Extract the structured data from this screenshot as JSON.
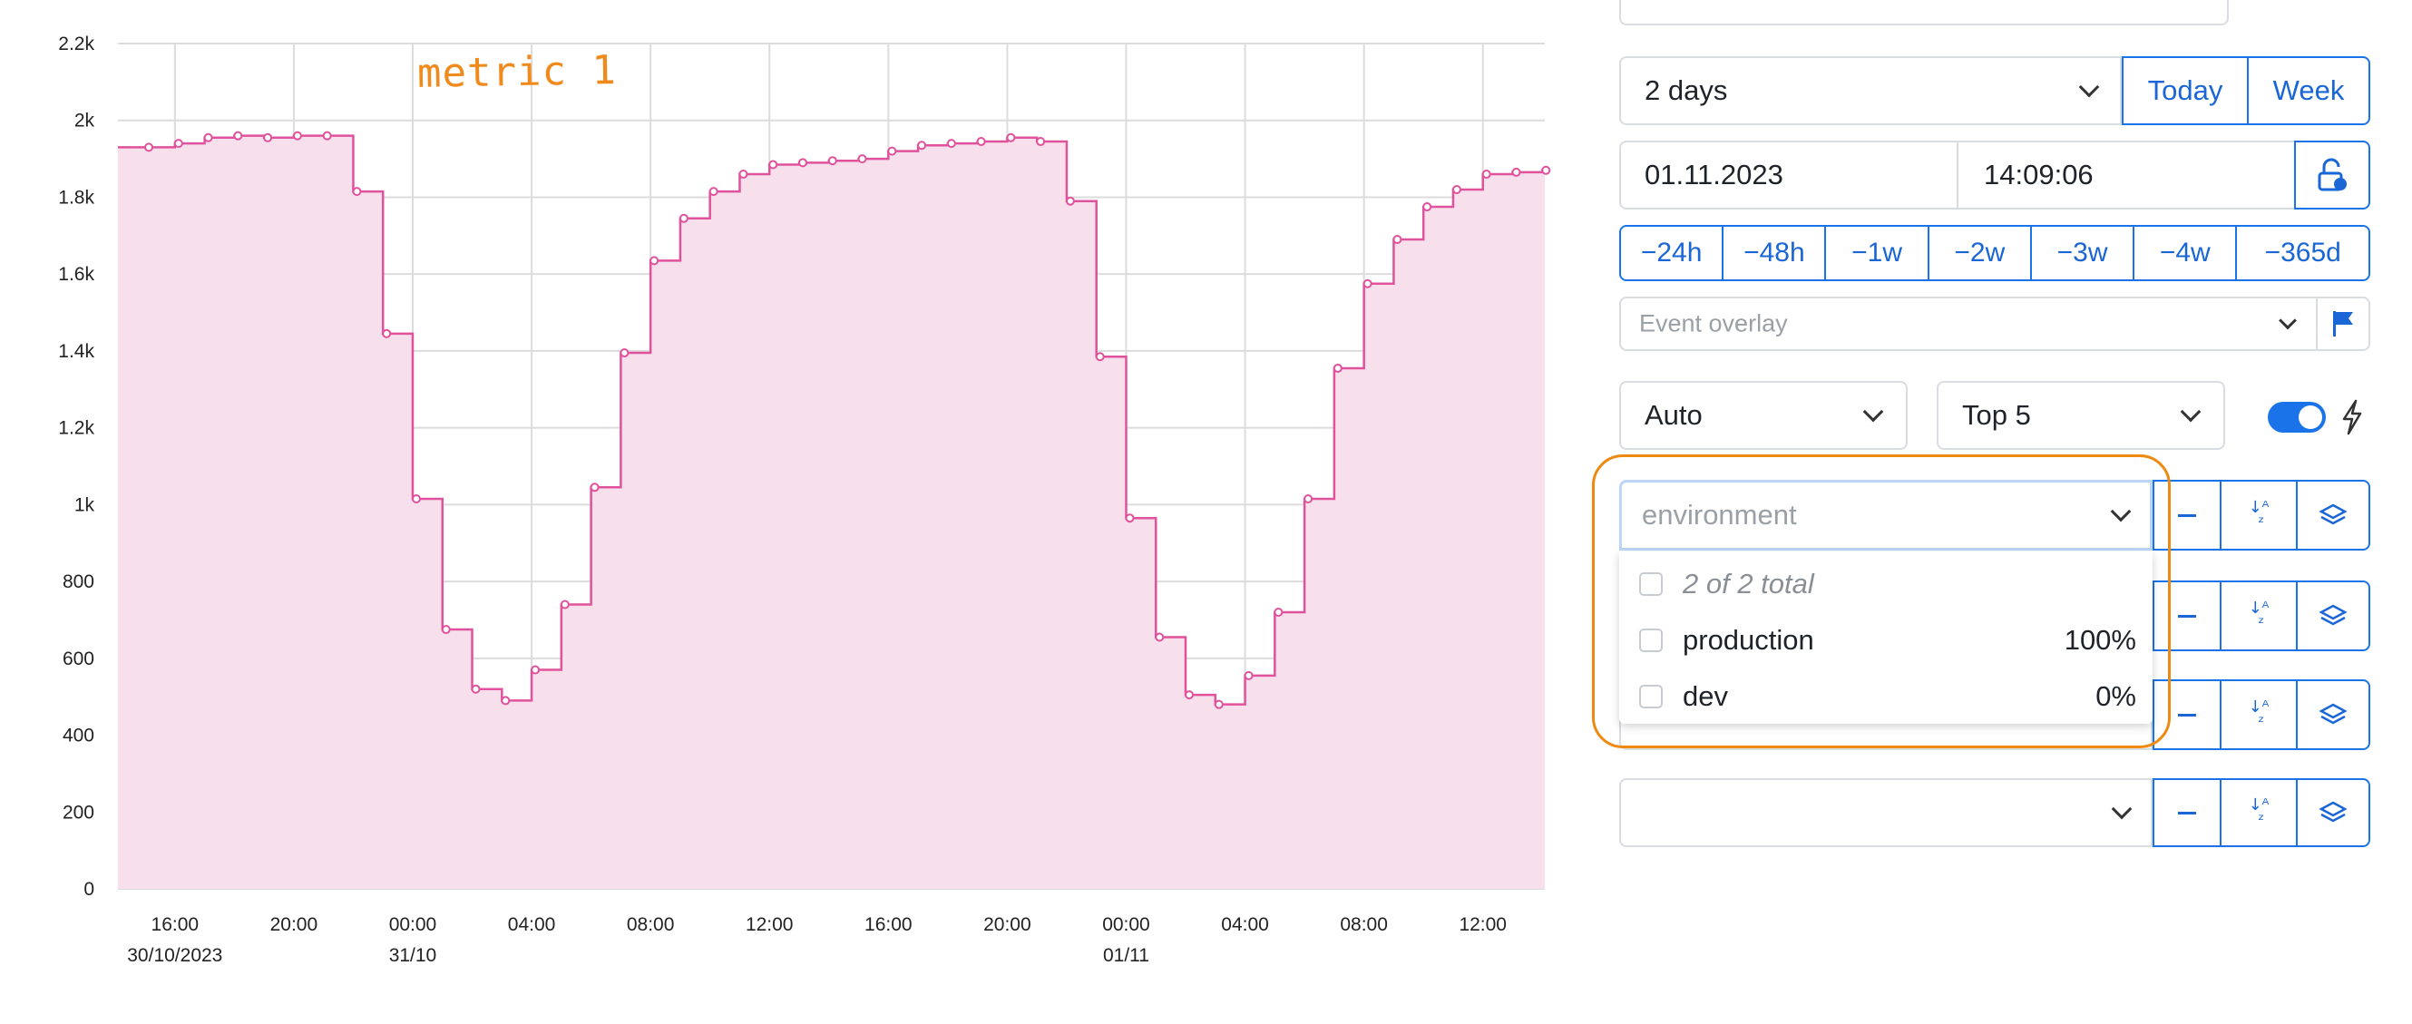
{
  "chart_data": {
    "type": "area",
    "step": true,
    "color": "#e0529c",
    "fill": "#f8dfec",
    "annotation": "metric 1",
    "ylim": [
      0,
      2200
    ],
    "y_ticks": [
      "0",
      "200",
      "400",
      "600",
      "800",
      "1k",
      "1.2k",
      "1.4k",
      "1.6k",
      "1.8k",
      "2k",
      "2.2k"
    ],
    "x_ticks": [
      {
        "label": "16:00",
        "sub": "30/10/2023"
      },
      {
        "label": "20:00",
        "sub": ""
      },
      {
        "label": "00:00",
        "sub": "31/10"
      },
      {
        "label": "04:00",
        "sub": ""
      },
      {
        "label": "08:00",
        "sub": ""
      },
      {
        "label": "12:00",
        "sub": ""
      },
      {
        "label": "16:00",
        "sub": ""
      },
      {
        "label": "20:00",
        "sub": ""
      },
      {
        "label": "00:00",
        "sub": "01/11"
      },
      {
        "label": "04:00",
        "sub": ""
      },
      {
        "label": "08:00",
        "sub": ""
      },
      {
        "label": "12:00",
        "sub": ""
      }
    ],
    "x_start": "2023-10-30 14:05",
    "x_end": "2023-11-01 14:05",
    "points": [
      {
        "t": "2023-10-30 15:00",
        "v": 1930
      },
      {
        "t": "2023-10-30 16:00",
        "v": 1940
      },
      {
        "t": "2023-10-30 17:00",
        "v": 1955
      },
      {
        "t": "2023-10-30 18:00",
        "v": 1960
      },
      {
        "t": "2023-10-30 19:00",
        "v": 1955
      },
      {
        "t": "2023-10-30 20:00",
        "v": 1960
      },
      {
        "t": "2023-10-30 21:00",
        "v": 1960
      },
      {
        "t": "2023-10-30 22:00",
        "v": 1815
      },
      {
        "t": "2023-10-30 23:00",
        "v": 1445
      },
      {
        "t": "2023-10-31 00:00",
        "v": 1015
      },
      {
        "t": "2023-10-31 01:00",
        "v": 675
      },
      {
        "t": "2023-10-31 02:00",
        "v": 520
      },
      {
        "t": "2023-10-31 03:00",
        "v": 490
      },
      {
        "t": "2023-10-31 04:00",
        "v": 570
      },
      {
        "t": "2023-10-31 05:00",
        "v": 740
      },
      {
        "t": "2023-10-31 06:00",
        "v": 1045
      },
      {
        "t": "2023-10-31 07:00",
        "v": 1395
      },
      {
        "t": "2023-10-31 08:00",
        "v": 1635
      },
      {
        "t": "2023-10-31 09:00",
        "v": 1745
      },
      {
        "t": "2023-10-31 10:00",
        "v": 1815
      },
      {
        "t": "2023-10-31 11:00",
        "v": 1860
      },
      {
        "t": "2023-10-31 12:00",
        "v": 1885
      },
      {
        "t": "2023-10-31 13:00",
        "v": 1890
      },
      {
        "t": "2023-10-31 14:00",
        "v": 1895
      },
      {
        "t": "2023-10-31 15:00",
        "v": 1900
      },
      {
        "t": "2023-10-31 16:00",
        "v": 1920
      },
      {
        "t": "2023-10-31 17:00",
        "v": 1935
      },
      {
        "t": "2023-10-31 18:00",
        "v": 1940
      },
      {
        "t": "2023-10-31 19:00",
        "v": 1945
      },
      {
        "t": "2023-10-31 20:00",
        "v": 1955
      },
      {
        "t": "2023-10-31 21:00",
        "v": 1945
      },
      {
        "t": "2023-10-31 22:00",
        "v": 1790
      },
      {
        "t": "2023-10-31 23:00",
        "v": 1385
      },
      {
        "t": "2023-11-01 00:00",
        "v": 965
      },
      {
        "t": "2023-11-01 01:00",
        "v": 655
      },
      {
        "t": "2023-11-01 02:00",
        "v": 505
      },
      {
        "t": "2023-11-01 03:00",
        "v": 480
      },
      {
        "t": "2023-11-01 04:00",
        "v": 555
      },
      {
        "t": "2023-11-01 05:00",
        "v": 720
      },
      {
        "t": "2023-11-01 06:00",
        "v": 1015
      },
      {
        "t": "2023-11-01 07:00",
        "v": 1355
      },
      {
        "t": "2023-11-01 08:00",
        "v": 1575
      },
      {
        "t": "2023-11-01 09:00",
        "v": 1690
      },
      {
        "t": "2023-11-01 10:00",
        "v": 1775
      },
      {
        "t": "2023-11-01 11:00",
        "v": 1820
      },
      {
        "t": "2023-11-01 12:00",
        "v": 1860
      },
      {
        "t": "2023-11-01 13:00",
        "v": 1865
      },
      {
        "t": "2023-11-01 14:00",
        "v": 1870
      }
    ],
    "grid": true,
    "legend": "none"
  },
  "controls": {
    "range": {
      "value": "2 days",
      "today_label": "Today",
      "week_label": "Week"
    },
    "date": {
      "date_value": "01.11.2023",
      "time_value": "14:09:06"
    },
    "shifts": [
      "−24h",
      "−48h",
      "−1w",
      "−2w",
      "−3w",
      "−4w",
      "−365d"
    ],
    "event_overlay": {
      "placeholder": "Event overlay"
    },
    "agg": {
      "value": "Auto"
    },
    "top": {
      "value": "Top 5"
    },
    "toggle_on": true,
    "filters": [
      {
        "placeholder": "environment",
        "active": true
      },
      {
        "placeholder": "",
        "active": false
      },
      {
        "placeholder": "",
        "active": false
      },
      {
        "placeholder": "",
        "active": false
      }
    ],
    "dropdown": {
      "summary": "2 of 2 total",
      "options": [
        {
          "label": "production",
          "pct": "100%"
        },
        {
          "label": "dev",
          "pct": "0%"
        }
      ]
    }
  }
}
